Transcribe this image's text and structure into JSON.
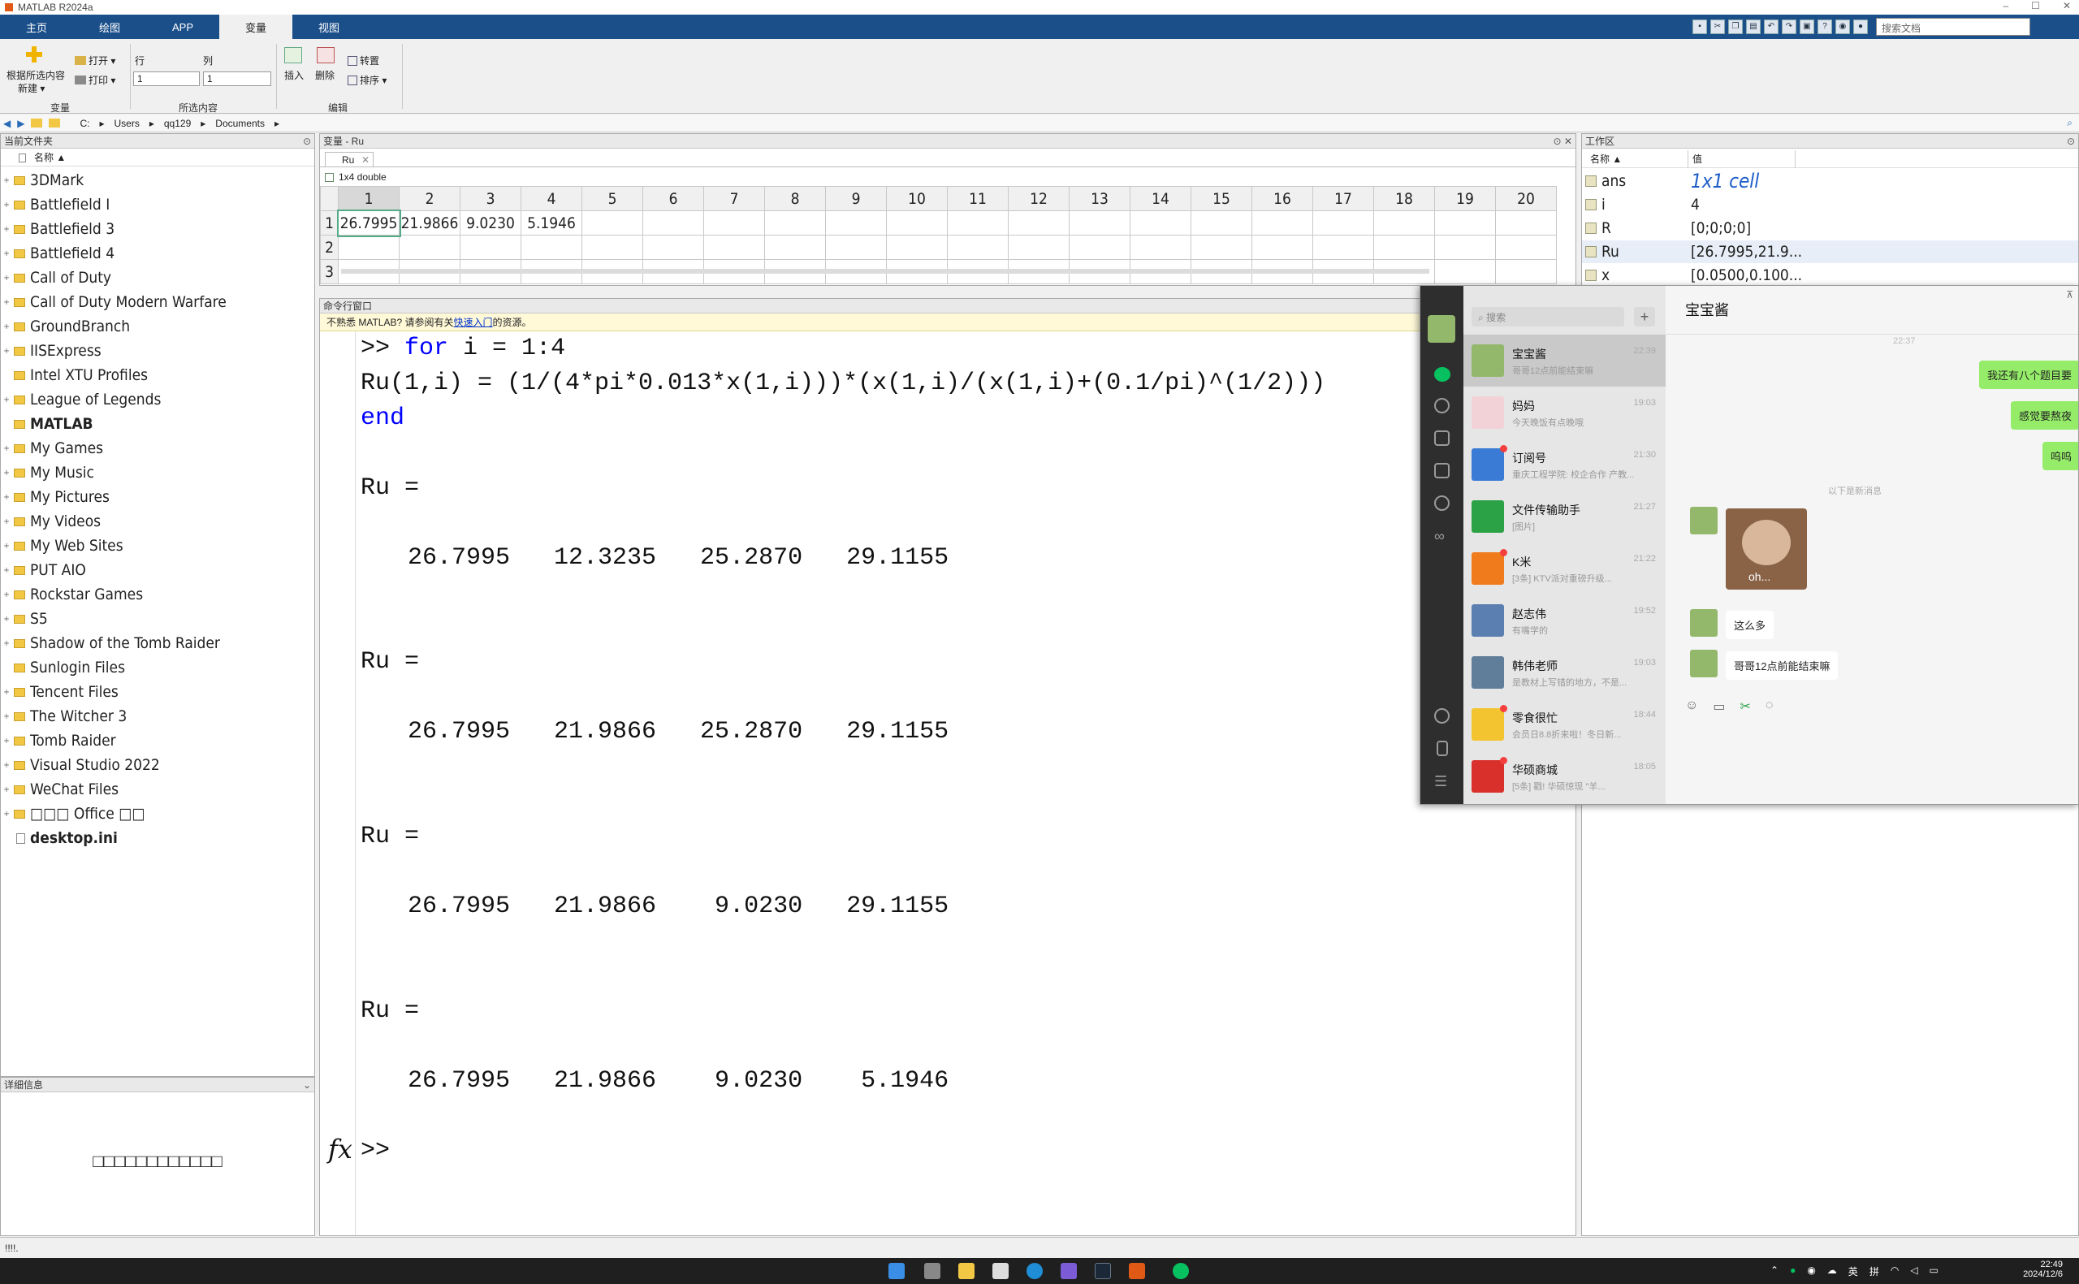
{
  "window": {
    "title": "MATLAB R2024a",
    "controls": [
      "–",
      "☐",
      "✕"
    ]
  },
  "ribbon": {
    "tabs": [
      "主页",
      "绘图",
      "APP",
      "变量",
      "视图"
    ],
    "active_tab": "变量",
    "search_placeholder": "搜索文档",
    "variable_group": {
      "new_from_selection": "根据所选内容",
      "new": "新建 ▾",
      "open": "打开 ▾",
      "print": "打印 ▾",
      "label": "变量"
    },
    "selection_group": {
      "row_label": "行",
      "col_label": "列",
      "row_value": "1",
      "col_value": "1",
      "label": "所选内容"
    },
    "edit_group": {
      "insert": "插入",
      "delete": "删除",
      "transpose": "转置",
      "sort": "排序 ▾",
      "label": "编辑"
    }
  },
  "address": {
    "crumbs": [
      "C:",
      "Users",
      "qq129",
      "Documents"
    ]
  },
  "current_folder": {
    "title": "当前文件夹",
    "column": "名称 ▲",
    "items": [
      {
        "name": "3DMark",
        "type": "folder",
        "exp": "+"
      },
      {
        "name": "Battlefield I",
        "type": "folder",
        "exp": "+"
      },
      {
        "name": "Battlefield 3",
        "type": "folder",
        "exp": "+"
      },
      {
        "name": "Battlefield 4",
        "type": "folder",
        "exp": "+"
      },
      {
        "name": "Call of Duty",
        "type": "folder",
        "exp": "+"
      },
      {
        "name": "Call of Duty Modern Warfare",
        "type": "folder",
        "exp": "+"
      },
      {
        "name": "GroundBranch",
        "type": "folder",
        "exp": "+"
      },
      {
        "name": "IISExpress",
        "type": "folder",
        "exp": "+"
      },
      {
        "name": "Intel XTU Profiles",
        "type": "folder",
        "exp": ""
      },
      {
        "name": "League of Legends",
        "type": "folder",
        "exp": "+"
      },
      {
        "name": "MATLAB",
        "type": "folder",
        "exp": "",
        "bold": true
      },
      {
        "name": "My Games",
        "type": "folder",
        "exp": "+"
      },
      {
        "name": "My Music",
        "type": "folder",
        "exp": "+"
      },
      {
        "name": "My Pictures",
        "type": "folder",
        "exp": "+"
      },
      {
        "name": "My Videos",
        "type": "folder",
        "exp": "+"
      },
      {
        "name": "My Web Sites",
        "type": "folder",
        "exp": "+"
      },
      {
        "name": "PUT AIO",
        "type": "folder",
        "exp": "+"
      },
      {
        "name": "Rockstar Games",
        "type": "folder",
        "exp": "+"
      },
      {
        "name": "S5",
        "type": "folder",
        "exp": "+"
      },
      {
        "name": "Shadow of the Tomb Raider",
        "type": "folder",
        "exp": "+"
      },
      {
        "name": "Sunlogin Files",
        "type": "folder",
        "exp": ""
      },
      {
        "name": "Tencent Files",
        "type": "folder",
        "exp": "+"
      },
      {
        "name": "The Witcher 3",
        "type": "folder",
        "exp": "+"
      },
      {
        "name": "Tomb Raider",
        "type": "folder",
        "exp": "+"
      },
      {
        "name": "Visual Studio 2022",
        "type": "folder",
        "exp": "+"
      },
      {
        "name": "WeChat Files",
        "type": "folder",
        "exp": "+"
      },
      {
        "name": "□□□ Office □□",
        "type": "folder",
        "exp": "+"
      },
      {
        "name": "desktop.ini",
        "type": "file",
        "exp": "",
        "bold": true
      }
    ]
  },
  "details": {
    "title": "详细信息",
    "message": "□□□□□□□□□□□□"
  },
  "variable_editor": {
    "title": "变量 - Ru",
    "tab": "Ru",
    "size_label": "1x4 double",
    "col_headers": [
      "1",
      "2",
      "3",
      "4",
      "5",
      "6",
      "7",
      "8",
      "9",
      "10",
      "11",
      "12",
      "13",
      "14",
      "15",
      "16",
      "17",
      "18",
      "19",
      "20"
    ],
    "row_headers": [
      "1",
      "2",
      "3"
    ],
    "row1": [
      "26.7995",
      "21.9866",
      "9.0230",
      "5.1946"
    ]
  },
  "command_window": {
    "title": "命令行窗口",
    "notice_prefix": "不熟悉 MATLAB? 请参阅有关",
    "notice_link": "快速入门",
    "notice_suffix": "的资源。",
    "prompt": ">>",
    "kw_for": "for",
    "for_rest": " i = 1:4",
    "line2": "Ru(1,i) = (1/(4*pi*0.013*x(1,i)))*(x(1,i)/(x(1,i)+(0.1/pi)^(1/2)))",
    "kw_end": "end",
    "ru_label": "Ru =",
    "outputs": [
      "26.7995   12.3235   25.2870   29.1155",
      "26.7995   21.9866   25.2870   29.1155",
      "26.7995   21.9866    9.0230   29.1155",
      "26.7995   21.9866    9.0230    5.1946"
    ],
    "fx": "fx"
  },
  "workspace": {
    "title": "工作区",
    "col_name": "名称 ▲",
    "col_value": "值",
    "rows": [
      {
        "name": "ans",
        "value": "1x1 cell"
      },
      {
        "name": "i",
        "value": "4"
      },
      {
        "name": "R",
        "value": "[0;0;0;0]"
      },
      {
        "name": "Ru",
        "value": "[26.7995,21.9..."
      },
      {
        "name": "x",
        "value": "[0.0500,0.100..."
      }
    ]
  },
  "wechat": {
    "search_placeholder": "搜索",
    "plus": "+",
    "chat_title": "宝宝酱",
    "contacts": [
      {
        "name": "宝宝酱",
        "time": "22:39",
        "preview": "哥哥12点前能结束嘛",
        "color": "#93b86b",
        "dot": false,
        "active": true
      },
      {
        "name": "妈妈",
        "time": "19:03",
        "preview": "今天晚饭有点晚哦",
        "color": "#f3d2d7",
        "dot": false
      },
      {
        "name": "订阅号",
        "time": "21:30",
        "preview": "重庆工程学院: 校企合作 产教...",
        "color": "#3a7bd5",
        "dot": true
      },
      {
        "name": "文件传输助手",
        "time": "21:27",
        "preview": "[图片]",
        "color": "#2ba245",
        "dot": false
      },
      {
        "name": "K米",
        "time": "21:22",
        "preview": "[3条] KTV派对重磅升级...",
        "color": "#f07b1d",
        "dot": true
      },
      {
        "name": "赵志伟",
        "time": "19:52",
        "preview": "有嘴学的",
        "color": "#5a7fb0",
        "dot": false
      },
      {
        "name": "韩伟老师",
        "time": "19:03",
        "preview": "是教材上写错的地方，不是...",
        "color": "#607d99",
        "dot": false
      },
      {
        "name": "零食很忙",
        "time": "18:44",
        "preview": "会员日8.8折来啦！冬日新...",
        "color": "#f4c430",
        "dot": true
      },
      {
        "name": "华硕商城",
        "time": "18:05",
        "preview": "[5条] 戳! 华硕惊现 \"羊...",
        "color": "#d9302c",
        "dot": true
      }
    ],
    "time_stamp": "22:37",
    "sent": [
      "我还有八个题目要",
      "感觉要熬夜",
      "呜呜"
    ],
    "divider": "以下是新消息",
    "image_caption": "oh...",
    "received": [
      "这么多",
      "哥哥12点前能结束嘛"
    ]
  },
  "status_bar": {
    "text": "!!!!."
  },
  "taskbar": {
    "ime1": "英",
    "ime2": "拼",
    "time": "22:49",
    "date": "2024/12/6"
  }
}
